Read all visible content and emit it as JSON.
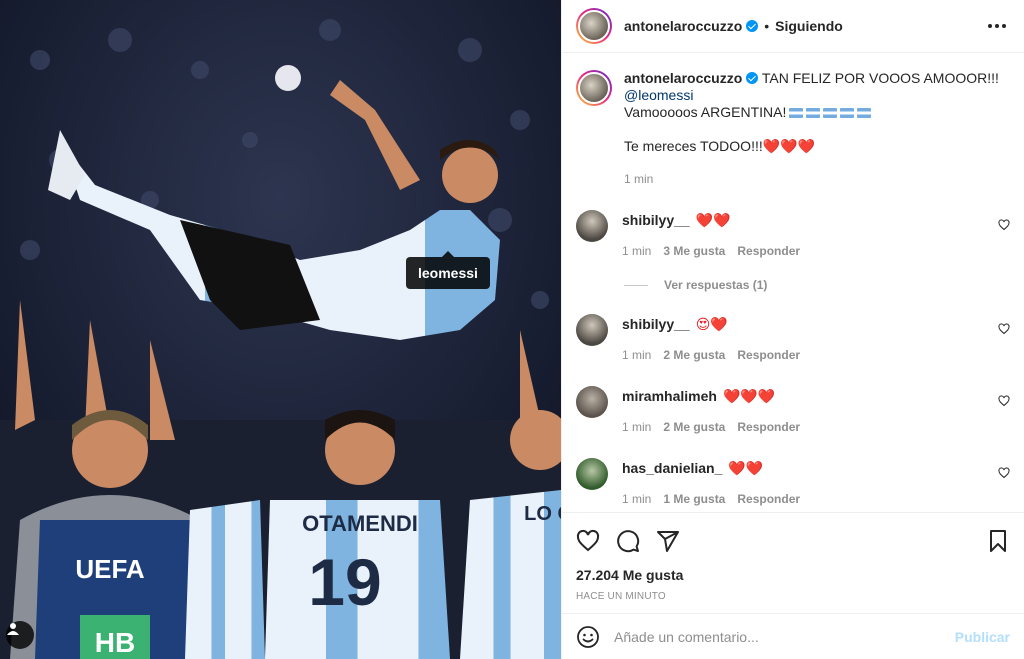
{
  "photo": {
    "tag_label": "leomessi",
    "jersey_name": "OTAMENDI",
    "jersey_number": "19",
    "jersey_name_right": "LO C",
    "bib_text": "UEFA",
    "bib_code": "HB"
  },
  "header": {
    "username": "antonelaroccuzzo",
    "follow_label": "Siguiendo",
    "dot": "•"
  },
  "caption": {
    "username": "antonelaroccuzzo",
    "line1": "TAN FELIZ POR VOOOS AMOOOR!!!",
    "mention": "@leomessi",
    "line3": "Vamooooos ARGENTINA!",
    "line4": "Te mereces TODOO!!!",
    "hearts": "❤️❤️❤️",
    "time": "1 min"
  },
  "comments": [
    {
      "username": "shibilyy__",
      "text": "❤️❤️",
      "time": "1 min",
      "likes": "3 Me gusta",
      "reply": "Responder",
      "view_replies": "Ver respuestas (1)"
    },
    {
      "username": "shibilyy__",
      "text": "😍❤️",
      "time": "1 min",
      "likes": "2 Me gusta",
      "reply": "Responder"
    },
    {
      "username": "miramhalimeh",
      "text": "❤️❤️❤️",
      "time": "1 min",
      "likes": "2 Me gusta",
      "reply": "Responder"
    },
    {
      "username": "has_danielian_",
      "text": "❤️❤️",
      "time": "1 min",
      "likes": "1 Me gusta",
      "reply": "Responder"
    }
  ],
  "actions": {
    "likes_count": "27.204 Me gusta",
    "posted_time": "HACE UN MINUTO"
  },
  "composer": {
    "placeholder": "Añade un comentario...",
    "publish_label": "Publicar"
  },
  "colors": {
    "accent_blue": "#0095f6",
    "link_blue": "#00376b",
    "muted": "#8e8e8e",
    "argentina_blue": "#74acdf"
  },
  "icons": [
    "more-icon",
    "verified-icon",
    "heart-icon",
    "comment-icon",
    "share-icon",
    "bookmark-icon",
    "emoji-icon",
    "user-tag-icon"
  ]
}
